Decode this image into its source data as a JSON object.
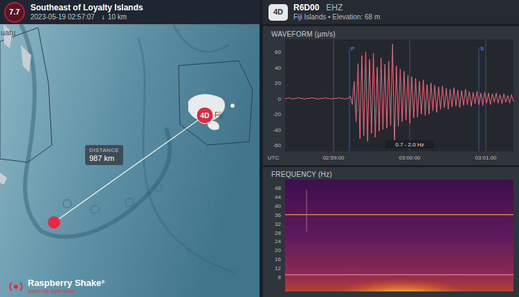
{
  "event": {
    "magnitude": "7.7",
    "title": "Southeast of Loyalty Islands",
    "time": "2023-05-19 02:57:07",
    "depth_arrow": "↓",
    "depth": "10 km"
  },
  "map": {
    "labels": [
      "uatu",
      "Fiji"
    ],
    "distance": {
      "label": "DISTANCE",
      "value": "987 km"
    },
    "station_pin": "4D"
  },
  "logo": {
    "name": "Raspberry Shake",
    "registered": "®",
    "tagline": "Watch the Earth Move"
  },
  "station": {
    "badge": "4D",
    "code": "R6D00",
    "channel": "EHZ",
    "subtitle": "Fiji Islands • Elevation: 68 m"
  },
  "waveform": {
    "title": "WAVEFORM (µm/s)",
    "y_ticks": [
      "60",
      "40",
      "20",
      "0",
      "-20",
      "-40",
      "-60"
    ],
    "axis_label": "UTC",
    "x_ticks": [
      "02:59:00",
      "03:00:00",
      "03:01:00"
    ],
    "markers": [
      {
        "label": "P"
      },
      {
        "label": "S"
      }
    ],
    "filter": "0.7 - 2.0 Hz",
    "values": [
      0,
      0,
      1,
      0,
      -1,
      0,
      0,
      1,
      0,
      0,
      -1,
      0,
      0,
      0,
      1,
      0,
      0,
      -1,
      0,
      0,
      0,
      1,
      0,
      0,
      -1,
      0,
      0,
      0,
      1,
      0,
      0,
      -1,
      0,
      0,
      3,
      -8,
      22,
      -30,
      45,
      -52,
      55,
      -48,
      60,
      -55,
      50,
      -45,
      58,
      -50,
      40,
      -42,
      52,
      -40,
      44,
      -38,
      48,
      -35,
      70,
      -60,
      42,
      -36,
      38,
      -30,
      35,
      -28,
      30,
      -32,
      28,
      -25,
      26,
      -24,
      22,
      -20,
      24,
      -22,
      18,
      -20,
      20,
      -16,
      17,
      -18,
      15,
      -14,
      16,
      -12,
      13,
      -14,
      12,
      -11,
      14,
      -10,
      11,
      -12,
      10,
      -9,
      12,
      -8,
      9,
      -10,
      8,
      -7,
      9,
      -8,
      7,
      -9,
      8,
      -6,
      7,
      -8,
      6,
      -5,
      7,
      -6,
      5,
      -7,
      6,
      -5,
      4,
      -6,
      5,
      -4
    ]
  },
  "frequency": {
    "title": "FREQUENCY (Hz)",
    "y_ticks": [
      "48",
      "44",
      "40",
      "36",
      "32",
      "28",
      "24",
      "20",
      "16",
      "12",
      "8"
    ],
    "constant_lines_hz": [
      36,
      9
    ]
  }
}
